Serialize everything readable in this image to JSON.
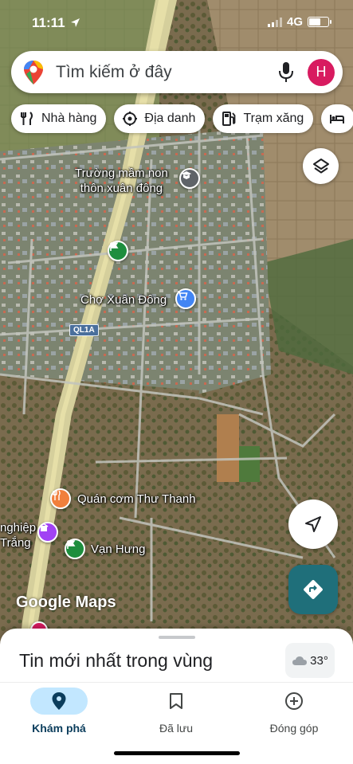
{
  "status_bar": {
    "time": "11:11",
    "network": "4G",
    "location_arrow": "location-arrow-icon"
  },
  "search": {
    "placeholder": "Tìm kiếm ở đây",
    "avatar_letter": "H",
    "avatar_color": "#d81b60"
  },
  "chips": [
    {
      "label": "Nhà hàng",
      "icon": "fork-knife-icon"
    },
    {
      "label": "Địa danh",
      "icon": "landmark-icon"
    },
    {
      "label": "Trạm xăng",
      "icon": "gas-station-icon"
    },
    {
      "label": "",
      "icon": "hotel-bed-icon"
    }
  ],
  "map": {
    "labels": {
      "school": "Trường mầm non\nthôn xuân đông",
      "market": "Chợ Xuân Đông",
      "restaurant": "Quán cơm Thư Thanh",
      "nghiep": "nghiệp\nTrắng",
      "van_hung": "Vạn Hưng",
      "road": "QL1A"
    },
    "attribution": "Google Maps"
  },
  "sheet": {
    "title": "Tin mới nhất trong vùng",
    "weather": "33°"
  },
  "nav": [
    {
      "label": "Khám phá",
      "icon": "explore-pin-icon",
      "active": true
    },
    {
      "label": "Đã lưu",
      "icon": "bookmark-icon",
      "active": false
    },
    {
      "label": "Đóng góp",
      "icon": "add-circle-icon",
      "active": false
    }
  ],
  "colors": {
    "accent": "#c2e7ff",
    "directions": "#1f6f7a",
    "market_pin": "#4285f4",
    "restaurant_pin": "#f17f3c",
    "park_pin": "#1e8e3e",
    "poi_purple": "#a142f4"
  }
}
